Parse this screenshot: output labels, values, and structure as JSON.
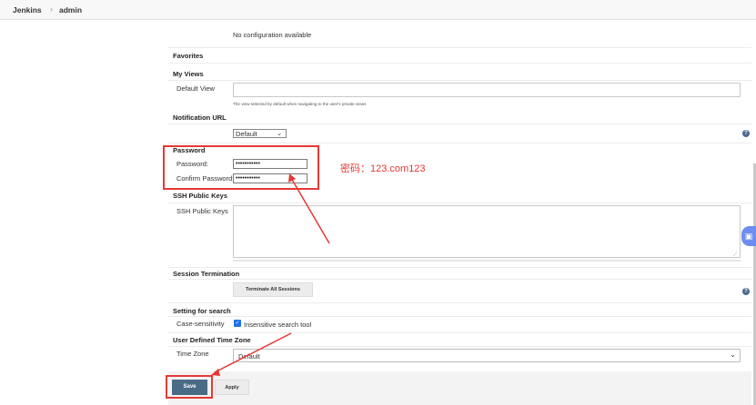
{
  "breadcrumb": {
    "root": "Jenkins",
    "separator": "›",
    "user": "admin"
  },
  "no_config": "No configuration available",
  "favorites": {
    "title": "Favorites"
  },
  "my_views": {
    "title": "My Views",
    "default_view_label": "Default View",
    "default_view_value": "",
    "hint": "The view selected by default when navigating to the user's private views"
  },
  "notification_url": {
    "title": "Notification URL",
    "selected": "Default"
  },
  "password": {
    "title": "Password",
    "password_label": "Password:",
    "password_value": "•••••••••••",
    "confirm_label": "Confirm Password:",
    "confirm_value": "•••••••••••"
  },
  "annotation": {
    "text": "密码：123.com123",
    "color": "#e53935"
  },
  "ssh": {
    "title": "SSH Public Keys",
    "label": "SSH Public Keys",
    "value": ""
  },
  "session": {
    "title": "Session Termination",
    "button": "Terminate All Sessions"
  },
  "search": {
    "title": "Setting for search",
    "label": "Case-sensitivity",
    "checkbox_label": "Insensitive search tool",
    "checked": true
  },
  "timezone": {
    "title": "User Defined Time Zone",
    "label": "Time Zone",
    "selected": "Default"
  },
  "actions": {
    "save": "Save",
    "apply": "Apply"
  },
  "icons": {
    "help": "help-icon",
    "widget": "translate-widget-icon"
  },
  "colors": {
    "save_button": "#4a6b85",
    "annotation": "#e53935",
    "help": "#4b6a8f"
  }
}
